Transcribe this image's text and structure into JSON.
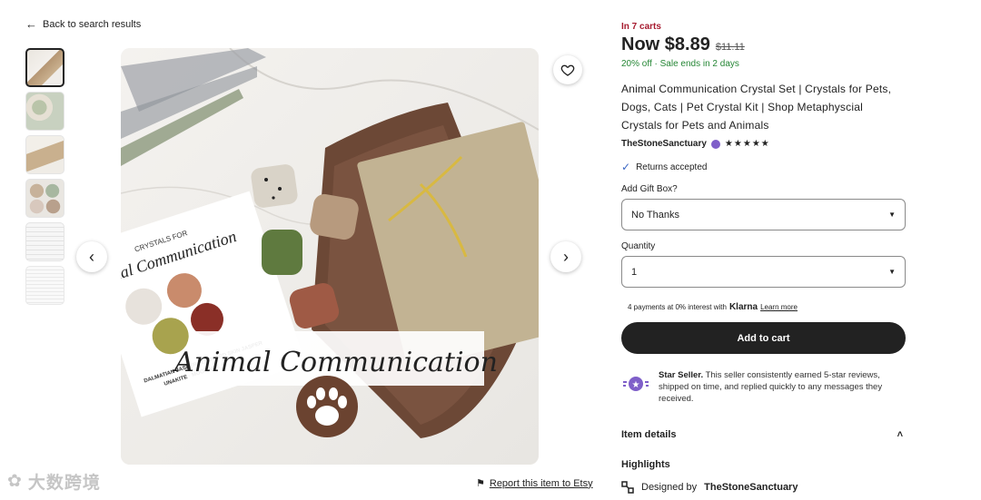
{
  "nav": {
    "back_label": "Back to search results"
  },
  "gallery": {
    "thumbnail_count": 6,
    "report_label": "Report this item to Etsy",
    "image_caption": "Animal Communication",
    "card_heading_1": "CRYSTALS FOR",
    "card_heading_2": "nal Communication",
    "card_text_1": "DALMATIAN JASPER · LEOPARD SKIN JASPER",
    "card_text_2": "UNAKITE · MOOKAITE"
  },
  "listing": {
    "carts_text": "In 7 carts",
    "price": "Now $8.89",
    "original_price": "$11.11",
    "sale_text": "20% off  ·  Sale ends in 2 days",
    "title": "Animal Communication Crystal Set | Crystals for Pets, Dogs, Cats | Pet Crystal Kit | Shop Metaphyscial Crystals for Pets and Animals",
    "shop_name": "TheStoneSanctuary",
    "rating_stars": "★★★★★",
    "returns_text": "Returns accepted",
    "gift_box": {
      "label": "Add Gift Box?",
      "selected": "No Thanks"
    },
    "quantity": {
      "label": "Quantity",
      "selected": "1"
    },
    "klarna": {
      "prefix": "4 payments at 0% interest with",
      "brand": "Klarna",
      "learn_more": "Learn more"
    },
    "add_to_cart_label": "Add to cart",
    "star_seller": {
      "title": "Star Seller.",
      "text": "This seller consistently earned 5-star reviews, shipped on time, and replied quickly to any messages they received."
    },
    "item_details_label": "Item details",
    "highlights_label": "Highlights",
    "designed_by_prefix": "Designed by",
    "designed_by_shop": "TheStoneSanctuary"
  },
  "watermark": {
    "text": "大数跨境"
  },
  "colors": {
    "carts_red": "#a61a2e",
    "sale_green": "#258635",
    "star_seller_purple": "#7f5fc9",
    "button_dark": "#222222"
  },
  "icons": {
    "back": "arrow-left-icon",
    "favorite": "heart-icon",
    "prev": "chevron-left-icon",
    "next": "chevron-right-icon",
    "report": "flag-icon",
    "returns": "checkmark-icon",
    "star_seller": "star-seller-badge-icon",
    "collapse": "chevron-up-icon",
    "designed": "design-tool-icon"
  }
}
